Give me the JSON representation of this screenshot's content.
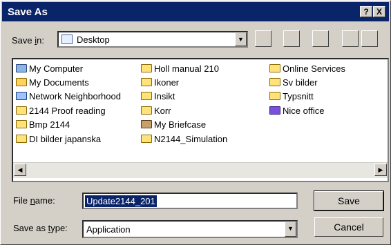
{
  "window": {
    "title": "Save As"
  },
  "title_buttons": {
    "help": "?",
    "close": "X"
  },
  "savein": {
    "label": "Save in:",
    "value": "Desktop"
  },
  "items": [
    {
      "name": "My Computer",
      "icon": "computer-icon"
    },
    {
      "name": "My Documents",
      "icon": "documents-folder-icon"
    },
    {
      "name": "Network Neighborhood",
      "icon": "network-icon"
    },
    {
      "name": "2144 Proof reading",
      "icon": "folder-icon"
    },
    {
      "name": "Bmp 2144",
      "icon": "folder-icon"
    },
    {
      "name": "DI bilder japanska",
      "icon": "folder-icon"
    },
    {
      "name": "Holl manual 210",
      "icon": "folder-icon"
    },
    {
      "name": "Ikoner",
      "icon": "folder-icon"
    },
    {
      "name": "Insikt",
      "icon": "folder-icon"
    },
    {
      "name": "Korr",
      "icon": "folder-icon"
    },
    {
      "name": "My Briefcase",
      "icon": "briefcase-icon"
    },
    {
      "name": "N2144_Simulation",
      "icon": "folder-icon"
    },
    {
      "name": "Online Services",
      "icon": "folder-icon"
    },
    {
      "name": "Sv bilder",
      "icon": "folder-icon"
    },
    {
      "name": "Typsnitt",
      "icon": "folder-icon"
    },
    {
      "name": "Nice office",
      "icon": "application-icon"
    }
  ],
  "filename": {
    "label": "File name:",
    "value": "Update2144_201"
  },
  "savetype": {
    "label": "Save as type:",
    "value": "Application"
  },
  "buttons": {
    "save": "Save",
    "cancel": "Cancel"
  }
}
